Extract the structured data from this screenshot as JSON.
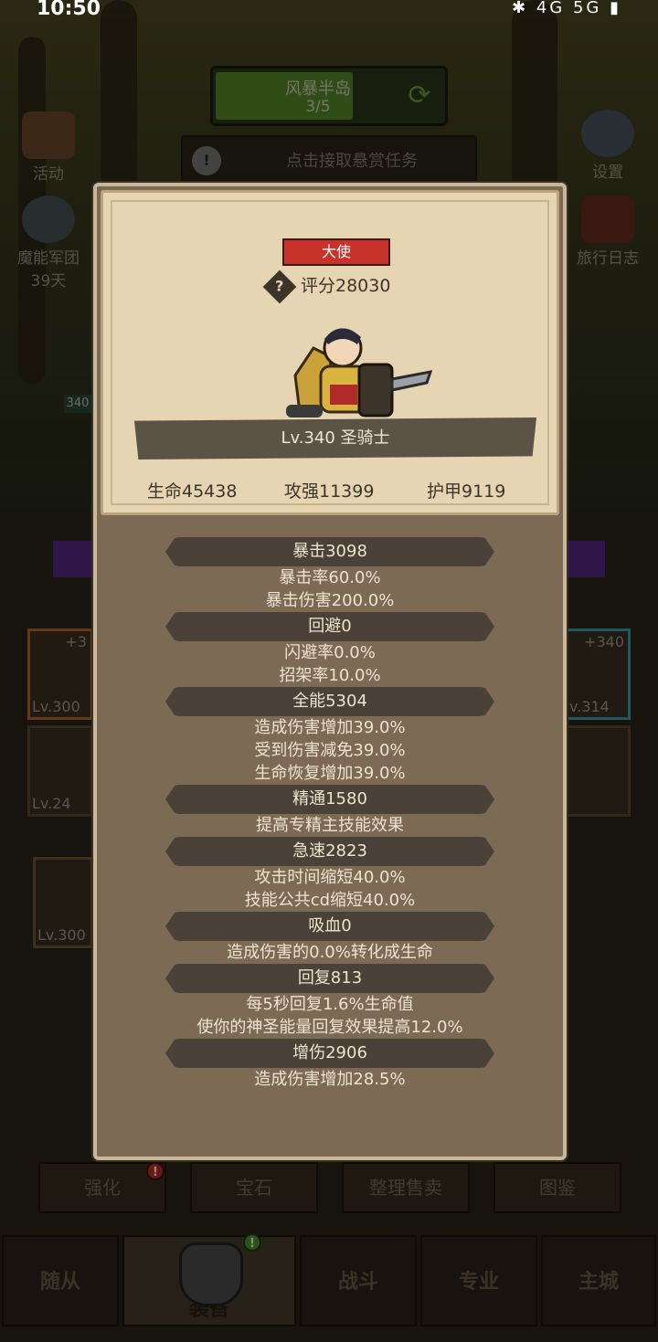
{
  "status_bar": {
    "time": "10:50",
    "icons": "✱ 4G 5G ▮"
  },
  "hud": {
    "stage_name": "风暴半岛",
    "stage_progress": "3/5",
    "bounty_text": "点击接取悬赏任务",
    "bounty_alert": "!",
    "left_buttons": [
      {
        "label": "活动"
      },
      {
        "label": "魔能军团",
        "sub": "39天"
      }
    ],
    "right_buttons": [
      {
        "label": "设置"
      },
      {
        "label": "旅行日志"
      }
    ]
  },
  "modal": {
    "title_badge": "大使",
    "score_icon": "?",
    "score": "评分28030",
    "hero_name": "Lv.340 圣骑士",
    "basic": [
      "生命45438",
      "攻强11399",
      "护甲9119"
    ],
    "stats": [
      {
        "head": "暴击3098",
        "lines": [
          "暴击率60.0%",
          "暴击伤害200.0%"
        ]
      },
      {
        "head": "回避0",
        "lines": [
          "闪避率0.0%",
          "招架率10.0%"
        ]
      },
      {
        "head": "全能5304",
        "lines": [
          "造成伤害增加39.0%",
          "受到伤害减免39.0%",
          "生命恢复增加39.0%"
        ]
      },
      {
        "head": "精通1580",
        "lines": [
          "提高专精主技能效果"
        ]
      },
      {
        "head": "急速2823",
        "lines": [
          "攻击时间缩短40.0%",
          "技能公共cd缩短40.0%"
        ]
      },
      {
        "head": "吸血0",
        "lines": [
          "造成伤害的0.0%转化成生命"
        ]
      },
      {
        "head": "回复813",
        "lines": [
          "每5秒回复1.6%生命值",
          "使你的神圣能量回复效果提高12.0%"
        ]
      },
      {
        "head": "增伤2906",
        "lines": [
          "造成伤害增加28.5%"
        ]
      }
    ]
  },
  "equipment_slots": [
    {
      "level": "Lv.300",
      "plus": "+3"
    },
    {
      "level": "Lv.24"
    },
    {
      "level": "Lv.300"
    },
    {
      "level": "v.314",
      "plus": "+340"
    }
  ],
  "side_badge": "340",
  "sub_tabs": [
    "强化",
    "宝石",
    "整理售卖",
    "图鉴"
  ],
  "sub_tab_alert": "!",
  "nav": [
    "随从",
    "装备",
    "战斗",
    "专业",
    "主城"
  ],
  "nav_badge": "!",
  "colors": {
    "badge_red": "#c8322b",
    "panel": "#7d6a55",
    "card": "#e6d5b3",
    "stage_green": "#5b8a2b"
  }
}
